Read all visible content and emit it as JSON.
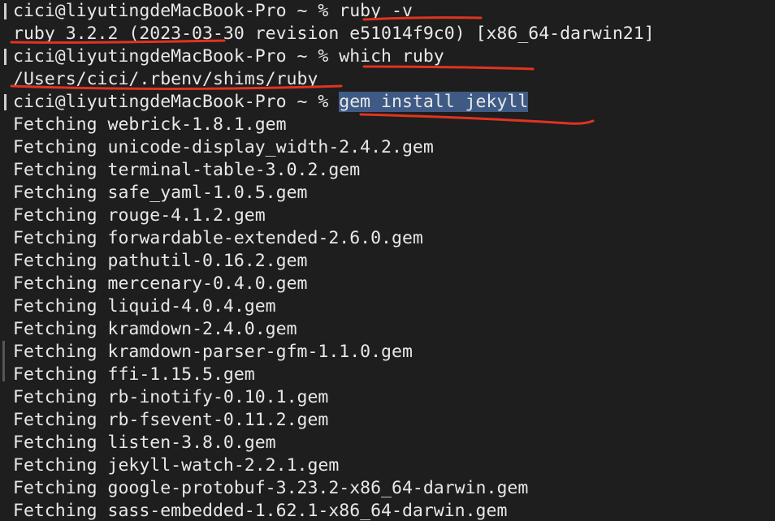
{
  "terminal": {
    "prompt": "cici@liyutingdeMacBook-Pro ~ %",
    "commands": [
      "ruby -v",
      "which ruby",
      "gem install jekyll"
    ],
    "outputs": {
      "ruby_version": "ruby 3.2.2 (2023-03-30 revision e51014f9c0) [x86_64-darwin21]",
      "which_ruby": "/Users/cici/.rbenv/shims/ruby"
    },
    "fetch_prefix": "Fetching",
    "fetched_gems": [
      "webrick-1.8.1.gem",
      "unicode-display_width-2.4.2.gem",
      "terminal-table-3.0.2.gem",
      "safe_yaml-1.0.5.gem",
      "rouge-4.1.2.gem",
      "forwardable-extended-2.6.0.gem",
      "pathutil-0.16.2.gem",
      "mercenary-0.4.0.gem",
      "liquid-4.0.4.gem",
      "kramdown-2.4.0.gem",
      "kramdown-parser-gfm-1.1.0.gem",
      "ffi-1.15.5.gem",
      "rb-inotify-0.10.1.gem",
      "rb-fsevent-0.11.2.gem",
      "listen-3.8.0.gem",
      "jekyll-watch-2.2.1.gem",
      "google-protobuf-3.23.2-x86_64-darwin.gem",
      "sass-embedded-1.62.1-x86_64-darwin.gem"
    ]
  },
  "colors": {
    "background": "#1e1e1e",
    "text": "#e8e8e8",
    "selection": "#3f5b85",
    "annotation": "#e0341f"
  }
}
